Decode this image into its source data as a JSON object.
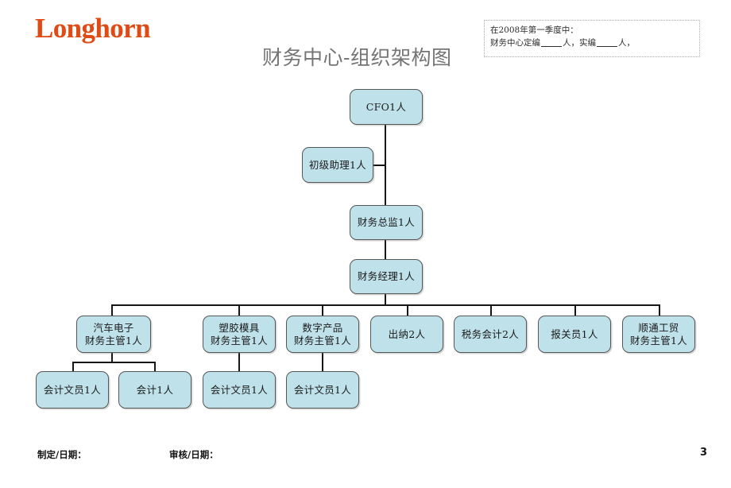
{
  "header": {
    "logo_text": "Longhorn",
    "logo_color": "#e04a15",
    "title": "财务中心-组织架构图",
    "title_color": "#747474"
  },
  "note_box": {
    "line1": "在2008年第一季度中：",
    "line2_part1": "财务中心定编",
    "line2_part2": "人，实编",
    "line2_part3": "人，"
  },
  "chart_data": {
    "type": "diagram",
    "title": "财务中心-组织架构图",
    "node_fill": "#bfe2ea",
    "node_border": "#575757",
    "line_color": "#161616",
    "nodes": [
      {
        "id": "cfo",
        "label": "CFO1人",
        "level": 0
      },
      {
        "id": "assistant",
        "label": "初级助理1人",
        "level": 1
      },
      {
        "id": "director",
        "label": "财务总监1人",
        "level": 2
      },
      {
        "id": "manager",
        "label": "财务经理1人",
        "level": 3
      },
      {
        "id": "auto",
        "label_l1": "汽车电子",
        "label_l2": "财务主管1人",
        "level": 4
      },
      {
        "id": "plastic",
        "label_l1": "塑胶模具",
        "label_l2": "财务主管1人",
        "level": 4
      },
      {
        "id": "digital",
        "label_l1": "数字产品",
        "label_l2": "财务主管1人",
        "level": 4
      },
      {
        "id": "cashier",
        "label": "出纳2人",
        "level": 4
      },
      {
        "id": "tax",
        "label": "税务会计2人",
        "level": 4
      },
      {
        "id": "customs",
        "label": "报关员1人",
        "level": 4
      },
      {
        "id": "shuntong",
        "label_l1": "顺通工贸",
        "label_l2": "财务主管1人",
        "level": 4
      },
      {
        "id": "clerk1",
        "label": "会计文员1人",
        "level": 5
      },
      {
        "id": "acct1",
        "label": "会计1人",
        "level": 5
      },
      {
        "id": "clerk2",
        "label": "会计文员1人",
        "level": 5
      },
      {
        "id": "clerk3",
        "label": "会计文员1人",
        "level": 5
      }
    ],
    "edges": [
      [
        "cfo",
        "assistant"
      ],
      [
        "cfo",
        "director"
      ],
      [
        "director",
        "manager"
      ],
      [
        "manager",
        "auto"
      ],
      [
        "manager",
        "plastic"
      ],
      [
        "manager",
        "digital"
      ],
      [
        "manager",
        "cashier"
      ],
      [
        "manager",
        "tax"
      ],
      [
        "manager",
        "customs"
      ],
      [
        "manager",
        "shuntong"
      ],
      [
        "auto",
        "clerk1"
      ],
      [
        "auto",
        "acct1"
      ],
      [
        "plastic",
        "clerk2"
      ],
      [
        "digital",
        "clerk3"
      ]
    ]
  },
  "footer": {
    "prepared": "制定/日期：",
    "reviewed": "审核/日期：",
    "page_number": "3"
  }
}
